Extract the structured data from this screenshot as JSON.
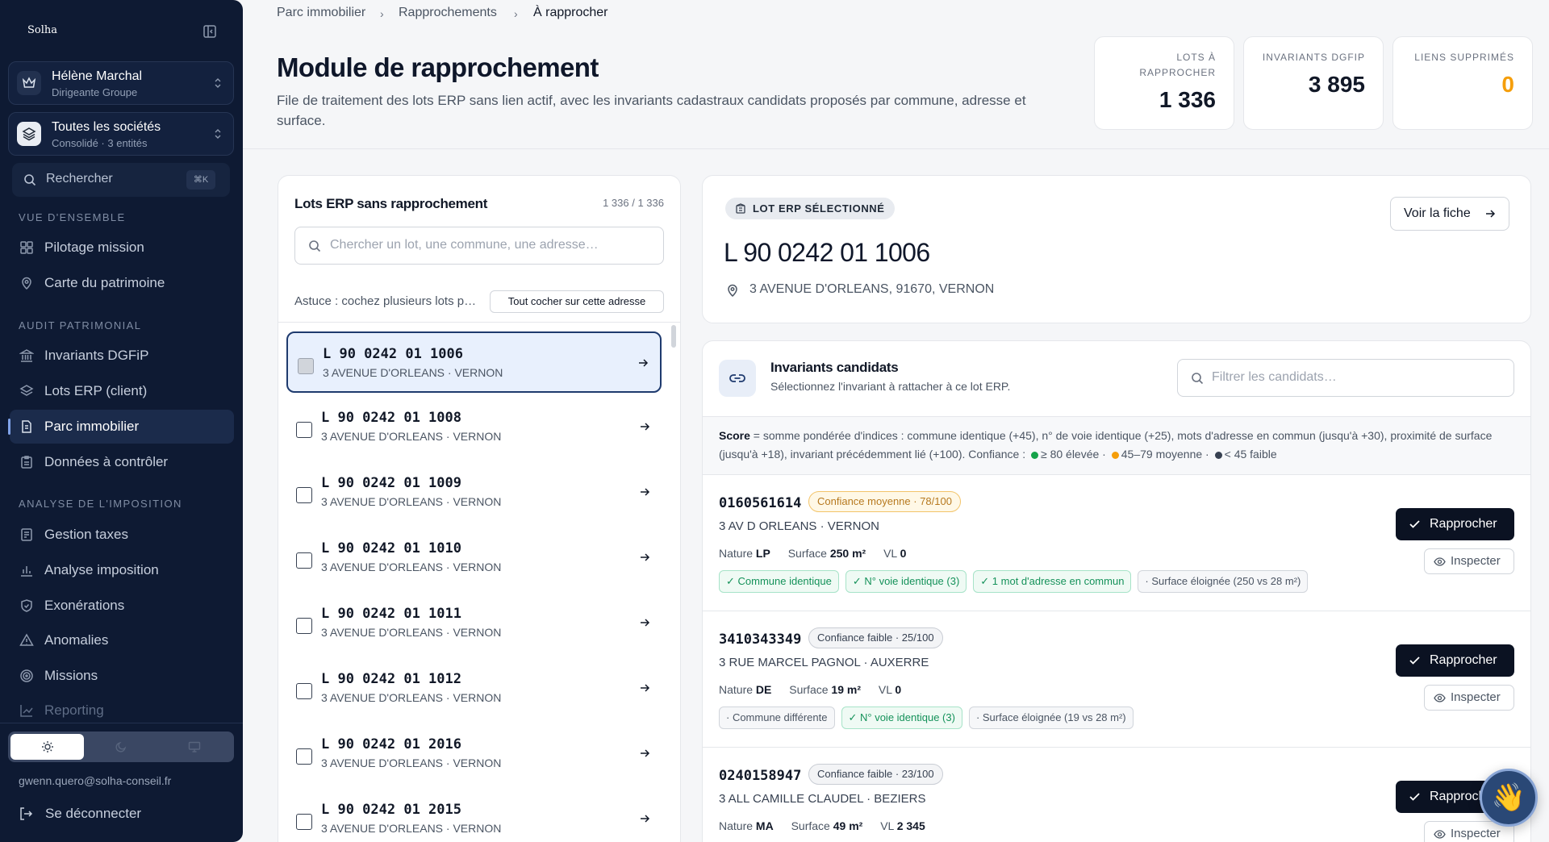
{
  "sidebar": {
    "brand": "Solha",
    "user": {
      "name": "Hélène Marchal",
      "role": "Dirigeante Groupe"
    },
    "company": {
      "name": "Toutes les sociétés",
      "sub": "Consolidé · 3 entités"
    },
    "search": {
      "label": "Rechercher",
      "shortcut": "⌘K"
    },
    "sections": [
      {
        "title": "VUE D'ENSEMBLE",
        "items": [
          {
            "label": "Pilotage mission",
            "icon": "grid-icon"
          },
          {
            "label": "Carte du patrimoine",
            "icon": "map-pin-icon"
          }
        ]
      },
      {
        "title": "AUDIT PATRIMONIAL",
        "items": [
          {
            "label": "Invariants DGFiP",
            "icon": "bank-icon"
          },
          {
            "label": "Lots ERP (client)",
            "icon": "layers-icon"
          },
          {
            "label": "Parc immobilier",
            "icon": "document-icon",
            "active": true
          },
          {
            "label": "Données à contrôler",
            "icon": "clipboard-icon"
          }
        ]
      },
      {
        "title": "ANALYSE DE L'IMPOSITION",
        "items": [
          {
            "label": "Gestion taxes",
            "icon": "receipt-icon"
          },
          {
            "label": "Analyse imposition",
            "icon": "bar-chart-icon"
          },
          {
            "label": "Exonérations",
            "icon": "shield-check-icon"
          },
          {
            "label": "Anomalies",
            "icon": "warning-icon"
          },
          {
            "label": "Missions",
            "icon": "target-icon"
          },
          {
            "label": "Reporting",
            "icon": "trend-icon"
          }
        ]
      }
    ],
    "email": "gwenn.quero@solha-conseil.fr",
    "logout": "Se déconnecter"
  },
  "breadcrumb": [
    "Parc immobilier",
    "Rapprochements",
    "À rapprocher"
  ],
  "page": {
    "title": "Module de rapprochement",
    "description": "File de traitement des lots ERP sans lien actif, avec les invariants cadastraux candidats proposés par commune, adresse et surface."
  },
  "kpis": [
    {
      "label_lines": [
        "LOTS À",
        "RAPPROCHER"
      ],
      "value": "1 336"
    },
    {
      "label_lines": [
        "INVARIANTS DGFIP"
      ],
      "value": "3 895"
    },
    {
      "label_lines": [
        "LIENS SUPPRIMÉS"
      ],
      "value": "0"
    }
  ],
  "lots_panel": {
    "title": "Lots ERP sans rapprochement",
    "count": "1 336 / 1 336",
    "search_placeholder": "Chercher un lot, une commune, une adresse…",
    "tip": "Astuce : cochez plusieurs lots p…",
    "check_all": "Tout cocher sur cette adresse",
    "lots": [
      {
        "code": "L 90 0242 01 1006",
        "addr": "3 AVENUE D'ORLEANS · VERNON",
        "selected": true
      },
      {
        "code": "L 90 0242 01 1008",
        "addr": "3 AVENUE D'ORLEANS · VERNON"
      },
      {
        "code": "L 90 0242 01 1009",
        "addr": "3 AVENUE D'ORLEANS · VERNON"
      },
      {
        "code": "L 90 0242 01 1010",
        "addr": "3 AVENUE D'ORLEANS · VERNON"
      },
      {
        "code": "L 90 0242 01 1011",
        "addr": "3 AVENUE D'ORLEANS · VERNON"
      },
      {
        "code": "L 90 0242 01 1012",
        "addr": "3 AVENUE D'ORLEANS · VERNON"
      },
      {
        "code": "L 90 0242 01 2016",
        "addr": "3 AVENUE D'ORLEANS · VERNON"
      },
      {
        "code": "L 90 0242 01 2015",
        "addr": "3 AVENUE D'ORLEANS · VERNON"
      }
    ]
  },
  "selected_lot": {
    "badge": "LOT ERP SÉLECTIONNÉ",
    "code": "L 90 0242 01 1006",
    "address": "3 AVENUE D'ORLEANS, 91670, VERNON",
    "button": "Voir la fiche"
  },
  "candidates": {
    "title": "Invariants candidats",
    "subtitle": "Sélectionnez l'invariant à rattacher à ce lot ERP.",
    "filter_placeholder": "Filtrer les candidats…",
    "legend": {
      "score_label": "Score",
      "text": " = somme pondérée d'indices : commune identique (+45), n° de voie identique (+25), mots d'adresse en commun (jusqu'à +30), proximité de surface (jusqu'à +18), invariant précédemment lié (+100). Confiance : ",
      "high": "≥ 80 élevée",
      "mid": "45–79 moyenne",
      "low": "< 45 faible",
      "sep": " · ",
      "colors": {
        "high": "#16a34a",
        "mid": "#f59e0b",
        "low": "#374151"
      }
    },
    "nature_label": "Nature",
    "surface_label": "Surface",
    "vl_label": "VL",
    "approve_label": "Rapprocher",
    "inspect_label": "Inspecter",
    "items": [
      {
        "id": "0160561614",
        "confidence": "Confiance moyenne · 78/100",
        "level": "mid",
        "address": "3 AV D ORLEANS · VERNON",
        "nature": "LP",
        "surface": "250 m²",
        "vl": "0",
        "tags": [
          {
            "text": "✓ Commune identique",
            "ok": true
          },
          {
            "text": "✓ N° voie identique (3)",
            "ok": true
          },
          {
            "text": "✓ 1 mot d'adresse en commun",
            "ok": true
          },
          {
            "text": "· Surface éloignée (250 vs 28 m²)",
            "ok": false
          }
        ]
      },
      {
        "id": "3410343349",
        "confidence": "Confiance faible · 25/100",
        "level": "low",
        "address": "3 RUE MARCEL PAGNOL · AUXERRE",
        "nature": "DE",
        "surface": "19 m²",
        "vl": "0",
        "tags": [
          {
            "text": "· Commune différente",
            "ok": false
          },
          {
            "text": "✓ N° voie identique (3)",
            "ok": true
          },
          {
            "text": "· Surface éloignée (19 vs 28 m²)",
            "ok": false
          }
        ]
      },
      {
        "id": "0240158947",
        "confidence": "Confiance faible · 23/100",
        "level": "low",
        "address": "3 ALL CAMILLE CLAUDEL · BEZIERS",
        "nature": "MA",
        "surface": "49 m²",
        "vl": "2 345",
        "tags": []
      }
    ]
  }
}
